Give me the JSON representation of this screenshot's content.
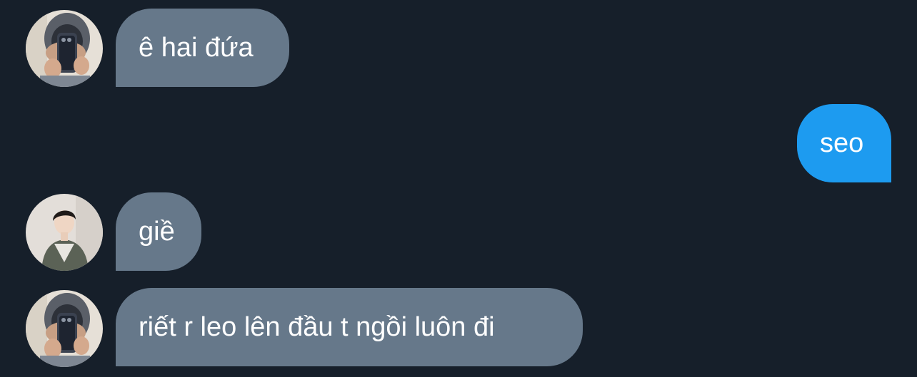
{
  "colors": {
    "background": "#161f2a",
    "incoming_bubble": "#66788a",
    "outgoing_bubble": "#1d9bf0",
    "text": "#ffffff"
  },
  "messages": [
    {
      "direction": "incoming",
      "text": "ê hai đứa",
      "avatar": "avatar-mirror-selfie"
    },
    {
      "direction": "outgoing",
      "text": "seo"
    },
    {
      "direction": "incoming",
      "text": "giề",
      "avatar": "avatar-portrait"
    },
    {
      "direction": "incoming",
      "text": "riết r leo lên đầu t ngồi luôn đi",
      "avatar": "avatar-mirror-selfie"
    }
  ]
}
